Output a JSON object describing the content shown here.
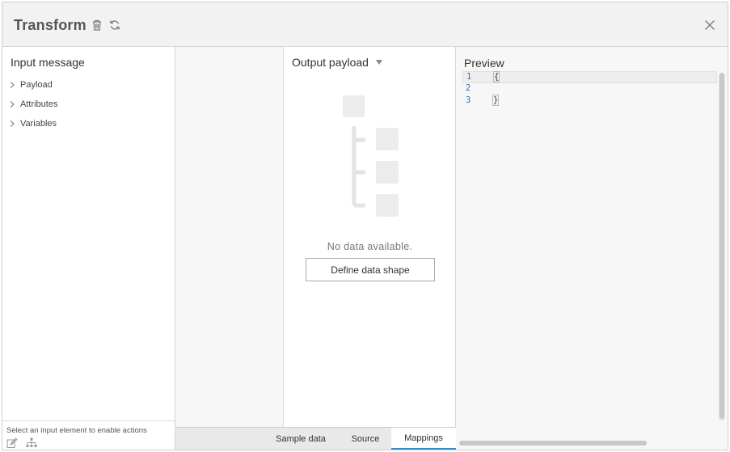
{
  "header": {
    "title": "Transform",
    "delete_icon": "trash-icon",
    "refresh_icon": "refresh-icon",
    "close_icon": "close-icon"
  },
  "input_panel": {
    "title": "Input message",
    "items": [
      {
        "label": "Payload",
        "icon": "chevron-right-icon"
      },
      {
        "label": "Attributes",
        "icon": "chevron-right-icon"
      },
      {
        "label": "Variables",
        "icon": "chevron-right-icon"
      }
    ],
    "footer_text": "Select an input element to enable actions",
    "footer_icons": [
      "edit-icon",
      "hierarchy-icon"
    ]
  },
  "output_panel": {
    "title": "Output payload",
    "empty_text": "No data available.",
    "define_button": "Define data shape"
  },
  "tabs": [
    {
      "label": "Sample data",
      "active": false
    },
    {
      "label": "Source",
      "active": false
    },
    {
      "label": "Mappings",
      "active": true
    }
  ],
  "preview": {
    "title": "Preview",
    "lines": [
      {
        "num": "1",
        "code": "{"
      },
      {
        "num": "2",
        "code": ""
      },
      {
        "num": "3",
        "code": "}"
      }
    ]
  },
  "colors": {
    "accent": "#2f8dca",
    "line_number": "#2f6fb5",
    "header_bg": "#f2f2f2"
  }
}
